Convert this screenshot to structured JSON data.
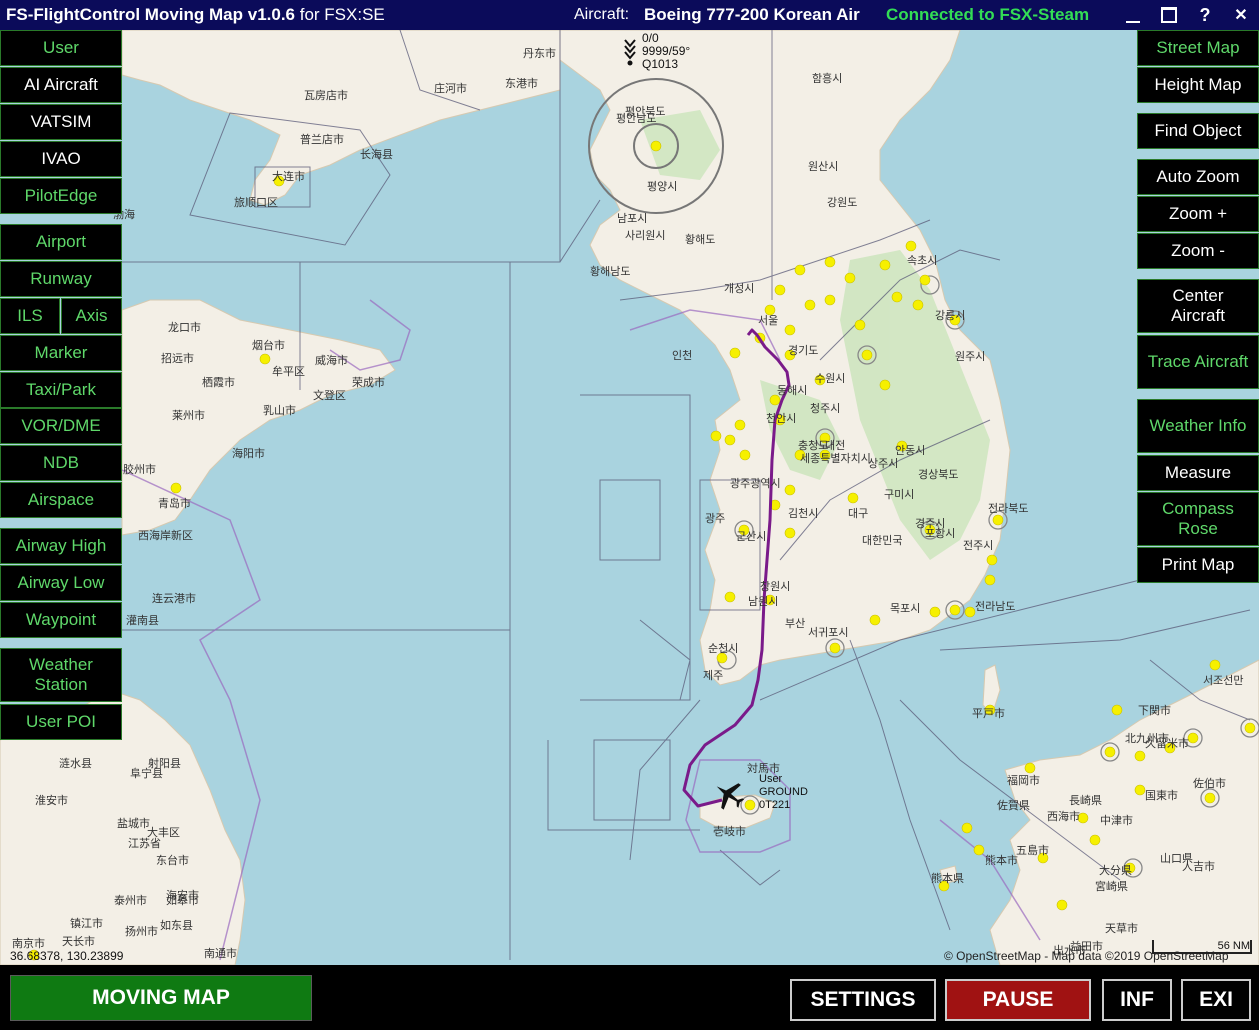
{
  "titlebar": {
    "app": "FS-FlightControl Moving Map v1.0.6",
    "sim": "for FSX:SE",
    "aircraft_label": "Aircraft:",
    "aircraft_name": "Boeing 777-200 Korean Air",
    "connection": "Connected to FSX-Steam",
    "minimize": "_",
    "maximize": "☐",
    "help": "?",
    "close": "✕"
  },
  "left_buttons": [
    {
      "label": "User",
      "active": true
    },
    {
      "label": "AI Aircraft",
      "active": false
    },
    {
      "label": "VATSIM",
      "active": false
    },
    {
      "label": "IVAO",
      "active": false
    },
    {
      "label": "PilotEdge",
      "active": true
    },
    {
      "label": "Airport",
      "active": true
    },
    {
      "label": "Runway",
      "active": true
    },
    {
      "label": "ILS",
      "active": true
    },
    {
      "label": "Axis",
      "active": true
    },
    {
      "label": "Marker",
      "active": true
    },
    {
      "label": "Taxi/Park",
      "active": true
    },
    {
      "label": "VOR/DME",
      "active": true
    },
    {
      "label": "NDB",
      "active": true
    },
    {
      "label": "Airspace",
      "active": true
    },
    {
      "label": "Airway High",
      "active": true
    },
    {
      "label": "Airway Low",
      "active": true
    },
    {
      "label": "Waypoint",
      "active": true
    },
    {
      "label": "Weather Station",
      "active": true
    },
    {
      "label": "User POI",
      "active": true
    }
  ],
  "right_buttons": [
    {
      "label": "Street Map",
      "active": true
    },
    {
      "label": "Height Map",
      "active": false
    },
    {
      "label": "Find Object",
      "active": false
    },
    {
      "label": "Auto Zoom",
      "active": false
    },
    {
      "label": "Zoom +",
      "active": false
    },
    {
      "label": "Zoom -",
      "active": false
    },
    {
      "label": "Center Aircraft",
      "active": false
    },
    {
      "label": "Trace Aircraft",
      "active": true
    },
    {
      "label": "Weather Info",
      "active": true
    },
    {
      "label": "Measure",
      "active": false
    },
    {
      "label": "Compass Rose",
      "active": true
    },
    {
      "label": "Print Map",
      "active": false
    }
  ],
  "weather_station": {
    "line1": "0/0",
    "line2": "9999/59°",
    "line3": "Q1013"
  },
  "user_aircraft": {
    "line1": "User",
    "line2": "GROUND",
    "line3": "0T221"
  },
  "map_labels": [
    "丹东市",
    "东港市",
    "庄河市",
    "瓦房店市",
    "普兰店市",
    "长海县",
    "大连市",
    "旅顺口区",
    "渤海",
    "烟台市",
    "龙口市",
    "招远市",
    "牟平区",
    "威海市",
    "栖霞市",
    "荣成市",
    "莱州市",
    "乳山市",
    "文登区",
    "海阳市",
    "胶州市",
    "青岛市",
    "西海岸新区",
    "连云港市",
    "灌南县",
    "淮安市",
    "涟水县",
    "阜宁县",
    "射阳县",
    "盐城市",
    "大丰区",
    "江苏省",
    "东台市",
    "如皋市",
    "泰州市",
    "海安市",
    "天长市",
    "镇江市",
    "扬州市",
    "南京市",
    "南通市",
    "如东县",
    "평양시",
    "남포시",
    "사리원시",
    "황해도",
    "황해남도",
    "평안남도",
    "평안북도",
    "원산시",
    "함흥시",
    "강원도",
    "개성시",
    "속초시",
    "강릉시",
    "서울",
    "인천",
    "경기도",
    "수원시",
    "원주시",
    "동해시",
    "천안시",
    "청주시",
    "충청도",
    "대전",
    "세종특별자치시",
    "상주시",
    "안동시",
    "경상북도",
    "구미시",
    "포항시",
    "김천시",
    "대구",
    "대한민국",
    "경주시",
    "전라북도",
    "전주시",
    "군산시",
    "광주",
    "광주광역시",
    "남원시",
    "창원시",
    "부산",
    "목포시",
    "전라남도",
    "순천시",
    "제주",
    "서귀포시",
    "対馬市",
    "壱岐市",
    "平戸市",
    "福岡市",
    "佐賀県",
    "長崎県",
    "西海市",
    "五島市",
    "熊本市",
    "熊本県",
    "大分県",
    "宮崎県",
    "山口県",
    "下関市",
    "北九州市",
    "久留米市",
    "中津市",
    "国東市",
    "佐伯市",
    "人吉市",
    "天草市",
    "出水市",
    "益田市",
    "서조선만"
  ],
  "coords": "36.68378, 130.23899",
  "scale": "56 NM",
  "attribution": "© OpenStreetMap - Map data ©2019 OpenStreetMap",
  "bottom": {
    "moving_map": "MOVING MAP",
    "settings": "SETTINGS",
    "pause": "PAUSE",
    "inf": "INF",
    "exit": "EXI"
  },
  "colors": {
    "title_bg": "#0b0b5a",
    "active_text": "#5fd86a",
    "moving_map_bg": "#0f7a12",
    "pause_bg": "#a01212",
    "trace": "#7a1a8a",
    "water": "#a9d3df",
    "land": "#f3efe6"
  }
}
